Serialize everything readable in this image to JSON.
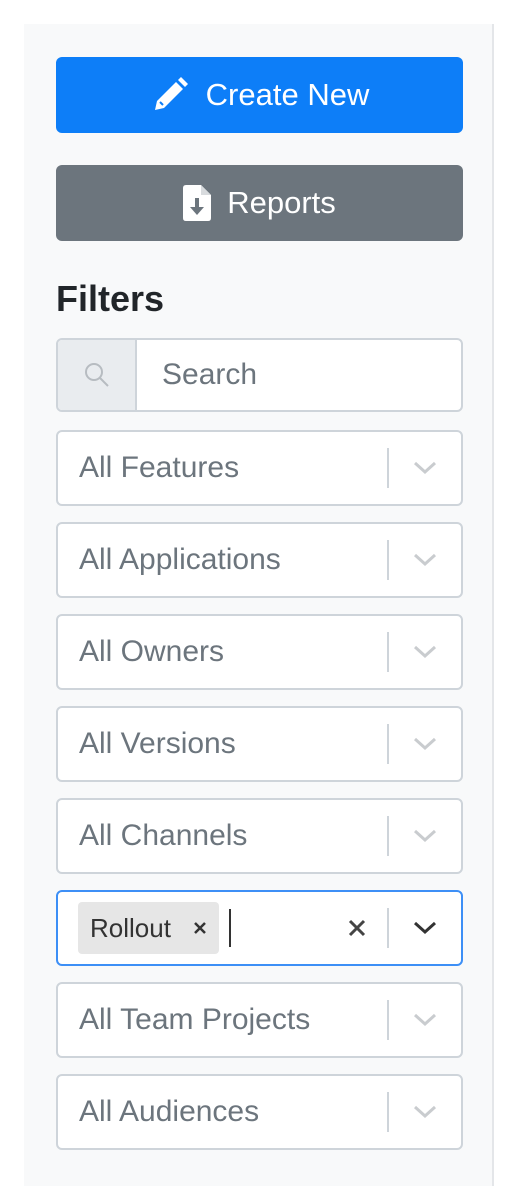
{
  "actions": {
    "create_label": "Create New",
    "reports_label": "Reports"
  },
  "filters": {
    "heading": "Filters",
    "search_placeholder": "Search",
    "selects": [
      {
        "label": "All Features"
      },
      {
        "label": "All Applications"
      },
      {
        "label": "All Owners"
      },
      {
        "label": "All Versions"
      },
      {
        "label": "All Channels"
      },
      {
        "selected_tags": [
          "Rollout"
        ]
      },
      {
        "label": "All Team Projects"
      },
      {
        "label": "All Audiences"
      }
    ]
  },
  "icons": {
    "create": "pencil-icon",
    "reports": "file-download-icon",
    "search": "search-icon",
    "dropdown": "chevron-down-icon",
    "remove_tag": "close-icon",
    "clear": "clear-icon"
  },
  "colors": {
    "primary": "#0d7ef8",
    "secondary": "#6c757d",
    "focus": "#3d8ff6"
  }
}
